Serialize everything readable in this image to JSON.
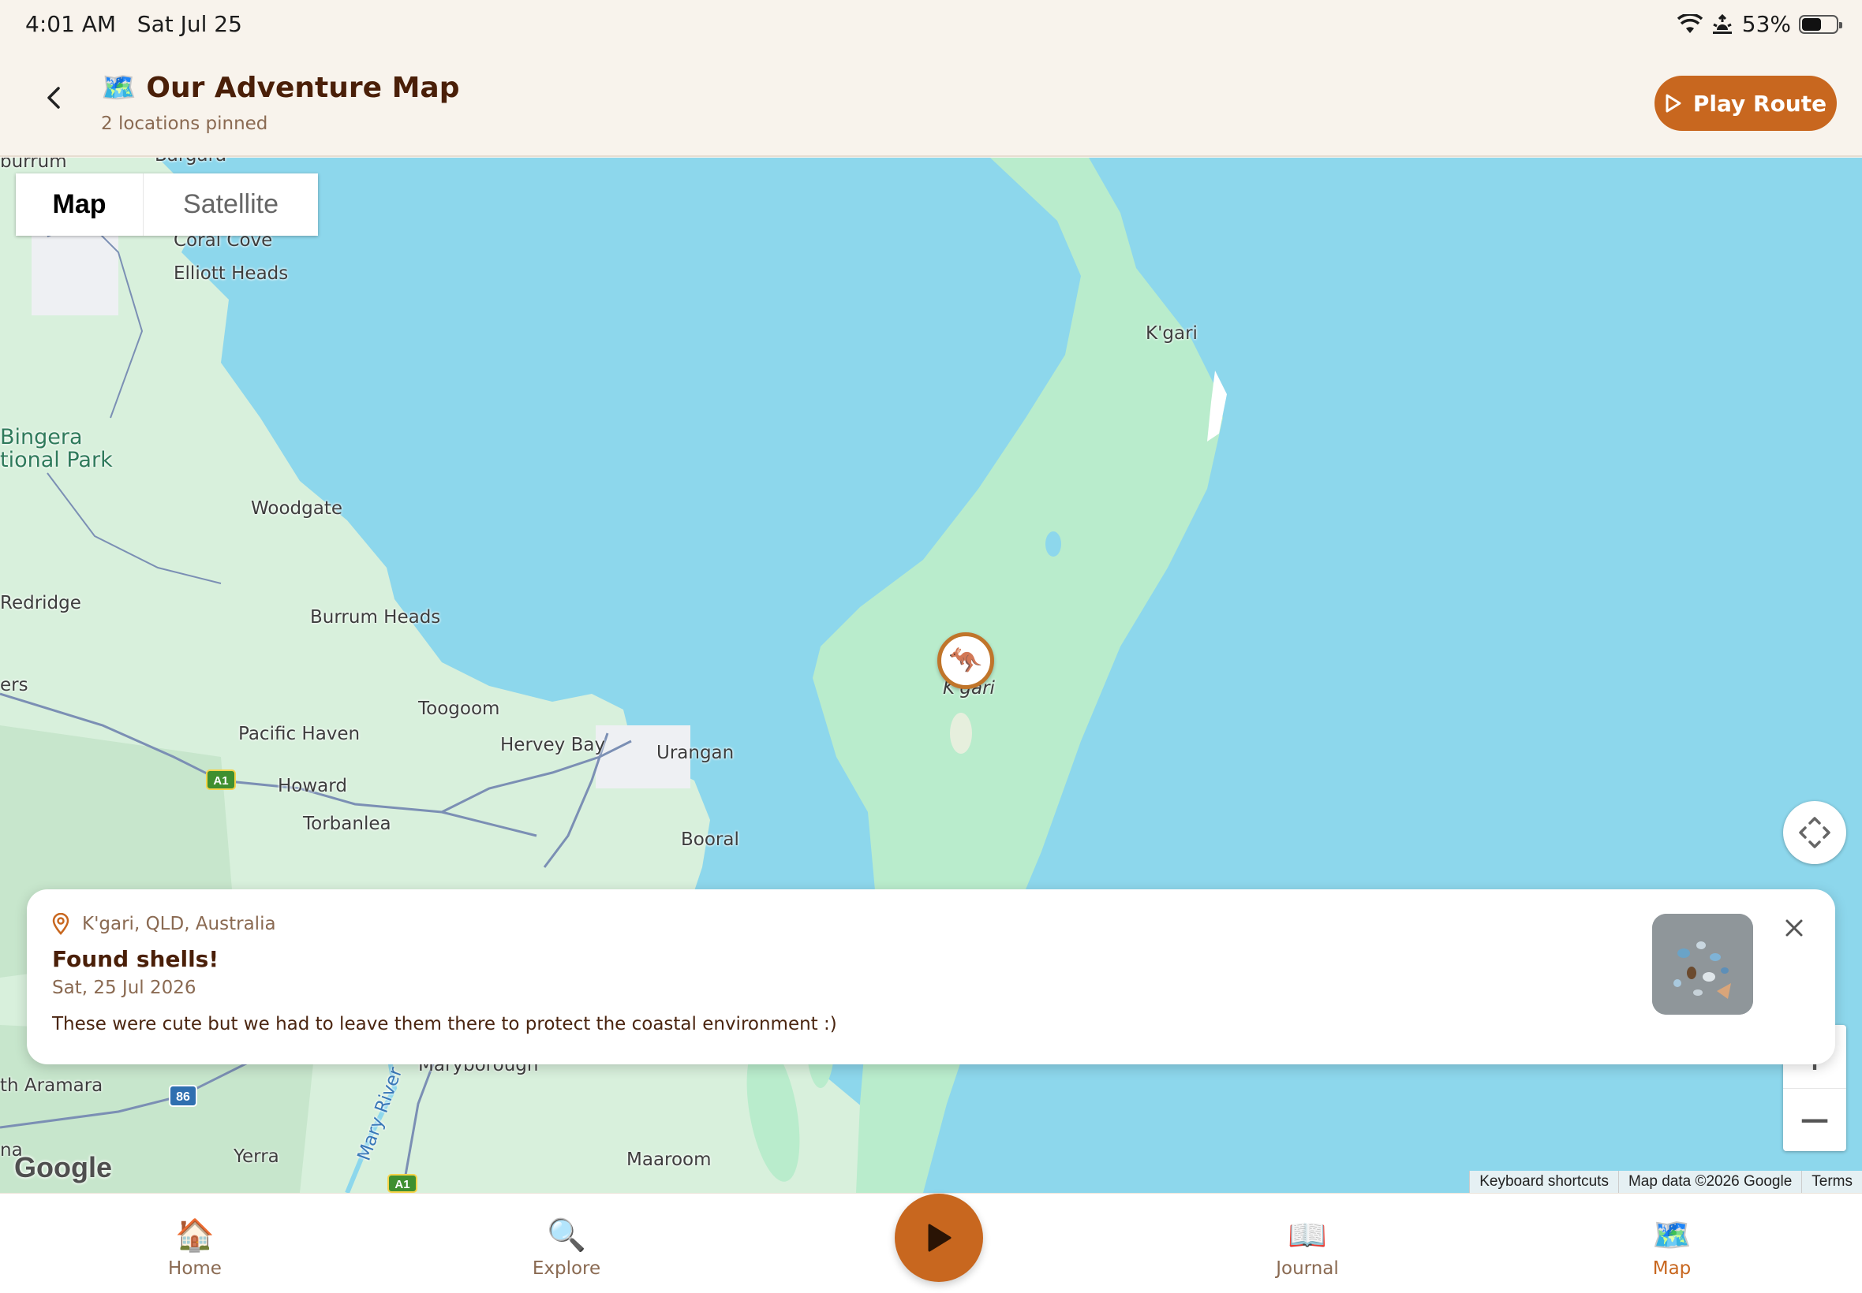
{
  "status_bar": {
    "time": "4:01 AM",
    "date": "Sat Jul 25",
    "battery": "53%",
    "battery_level": 0.53
  },
  "header": {
    "title_emoji": "🗺️",
    "title": "Our Adventure Map",
    "subtitle": "2 locations pinned",
    "play_route_label": "Play Route"
  },
  "map": {
    "type_options": [
      "Map",
      "Satellite"
    ],
    "selected_type": "Map",
    "labels": {
      "burrum_cut": "burrum",
      "bargara": "Bargara",
      "coral_cove": "Coral Cove",
      "elliott_heads": "Elliott Heads",
      "kgari_north": "K'gari",
      "bingera_1": "Bingera",
      "bingera_2": "tional Park",
      "woodgate": "Woodgate",
      "redridge": "Redridge",
      "burrum_heads": "Burrum Heads",
      "ers": "ers",
      "toogoom": "Toogoom",
      "kgari_marker": "K'gari",
      "pacific_haven": "Pacific Haven",
      "hervey_bay": "Hervey Bay",
      "urangan": "Urangan",
      "howard": "Howard",
      "torbanlea": "Torbanlea",
      "booral": "Booral",
      "maryborough": "Maryborough",
      "aramara": "th Aramara",
      "mary_river": "Mary River",
      "yerra": "Yerra",
      "maaroom": "Maaroom",
      "na": "na"
    },
    "road_shields": {
      "a1_north": "A1",
      "a1_south": "A1",
      "r86": "86"
    },
    "marker_emoji": "🦘",
    "google_logo": "Google",
    "attribution": [
      "Keyboard shortcuts",
      "Map data ©2026 Google",
      "Terms"
    ],
    "zoom_in": "+",
    "zoom_out": "−"
  },
  "card": {
    "location": "K'gari, QLD, Australia",
    "title": "Found shells!",
    "date": "Sat, 25 Jul 2026",
    "description": "These were cute but we had to leave them there to protect the coastal environment :)"
  },
  "tabbar": {
    "tabs": [
      {
        "label": "Home",
        "emoji": "🏠"
      },
      {
        "label": "Explore",
        "emoji": "🔍"
      },
      {
        "label": "Journal",
        "emoji": "📖"
      },
      {
        "label": "Map",
        "emoji": "🗺️"
      }
    ],
    "active": "Map"
  },
  "colors": {
    "accent": "#c8671f",
    "water": "#8dd7ec",
    "land": "#d8f0dc",
    "island": "#b9eccc",
    "title_brown": "#4a1f08"
  }
}
